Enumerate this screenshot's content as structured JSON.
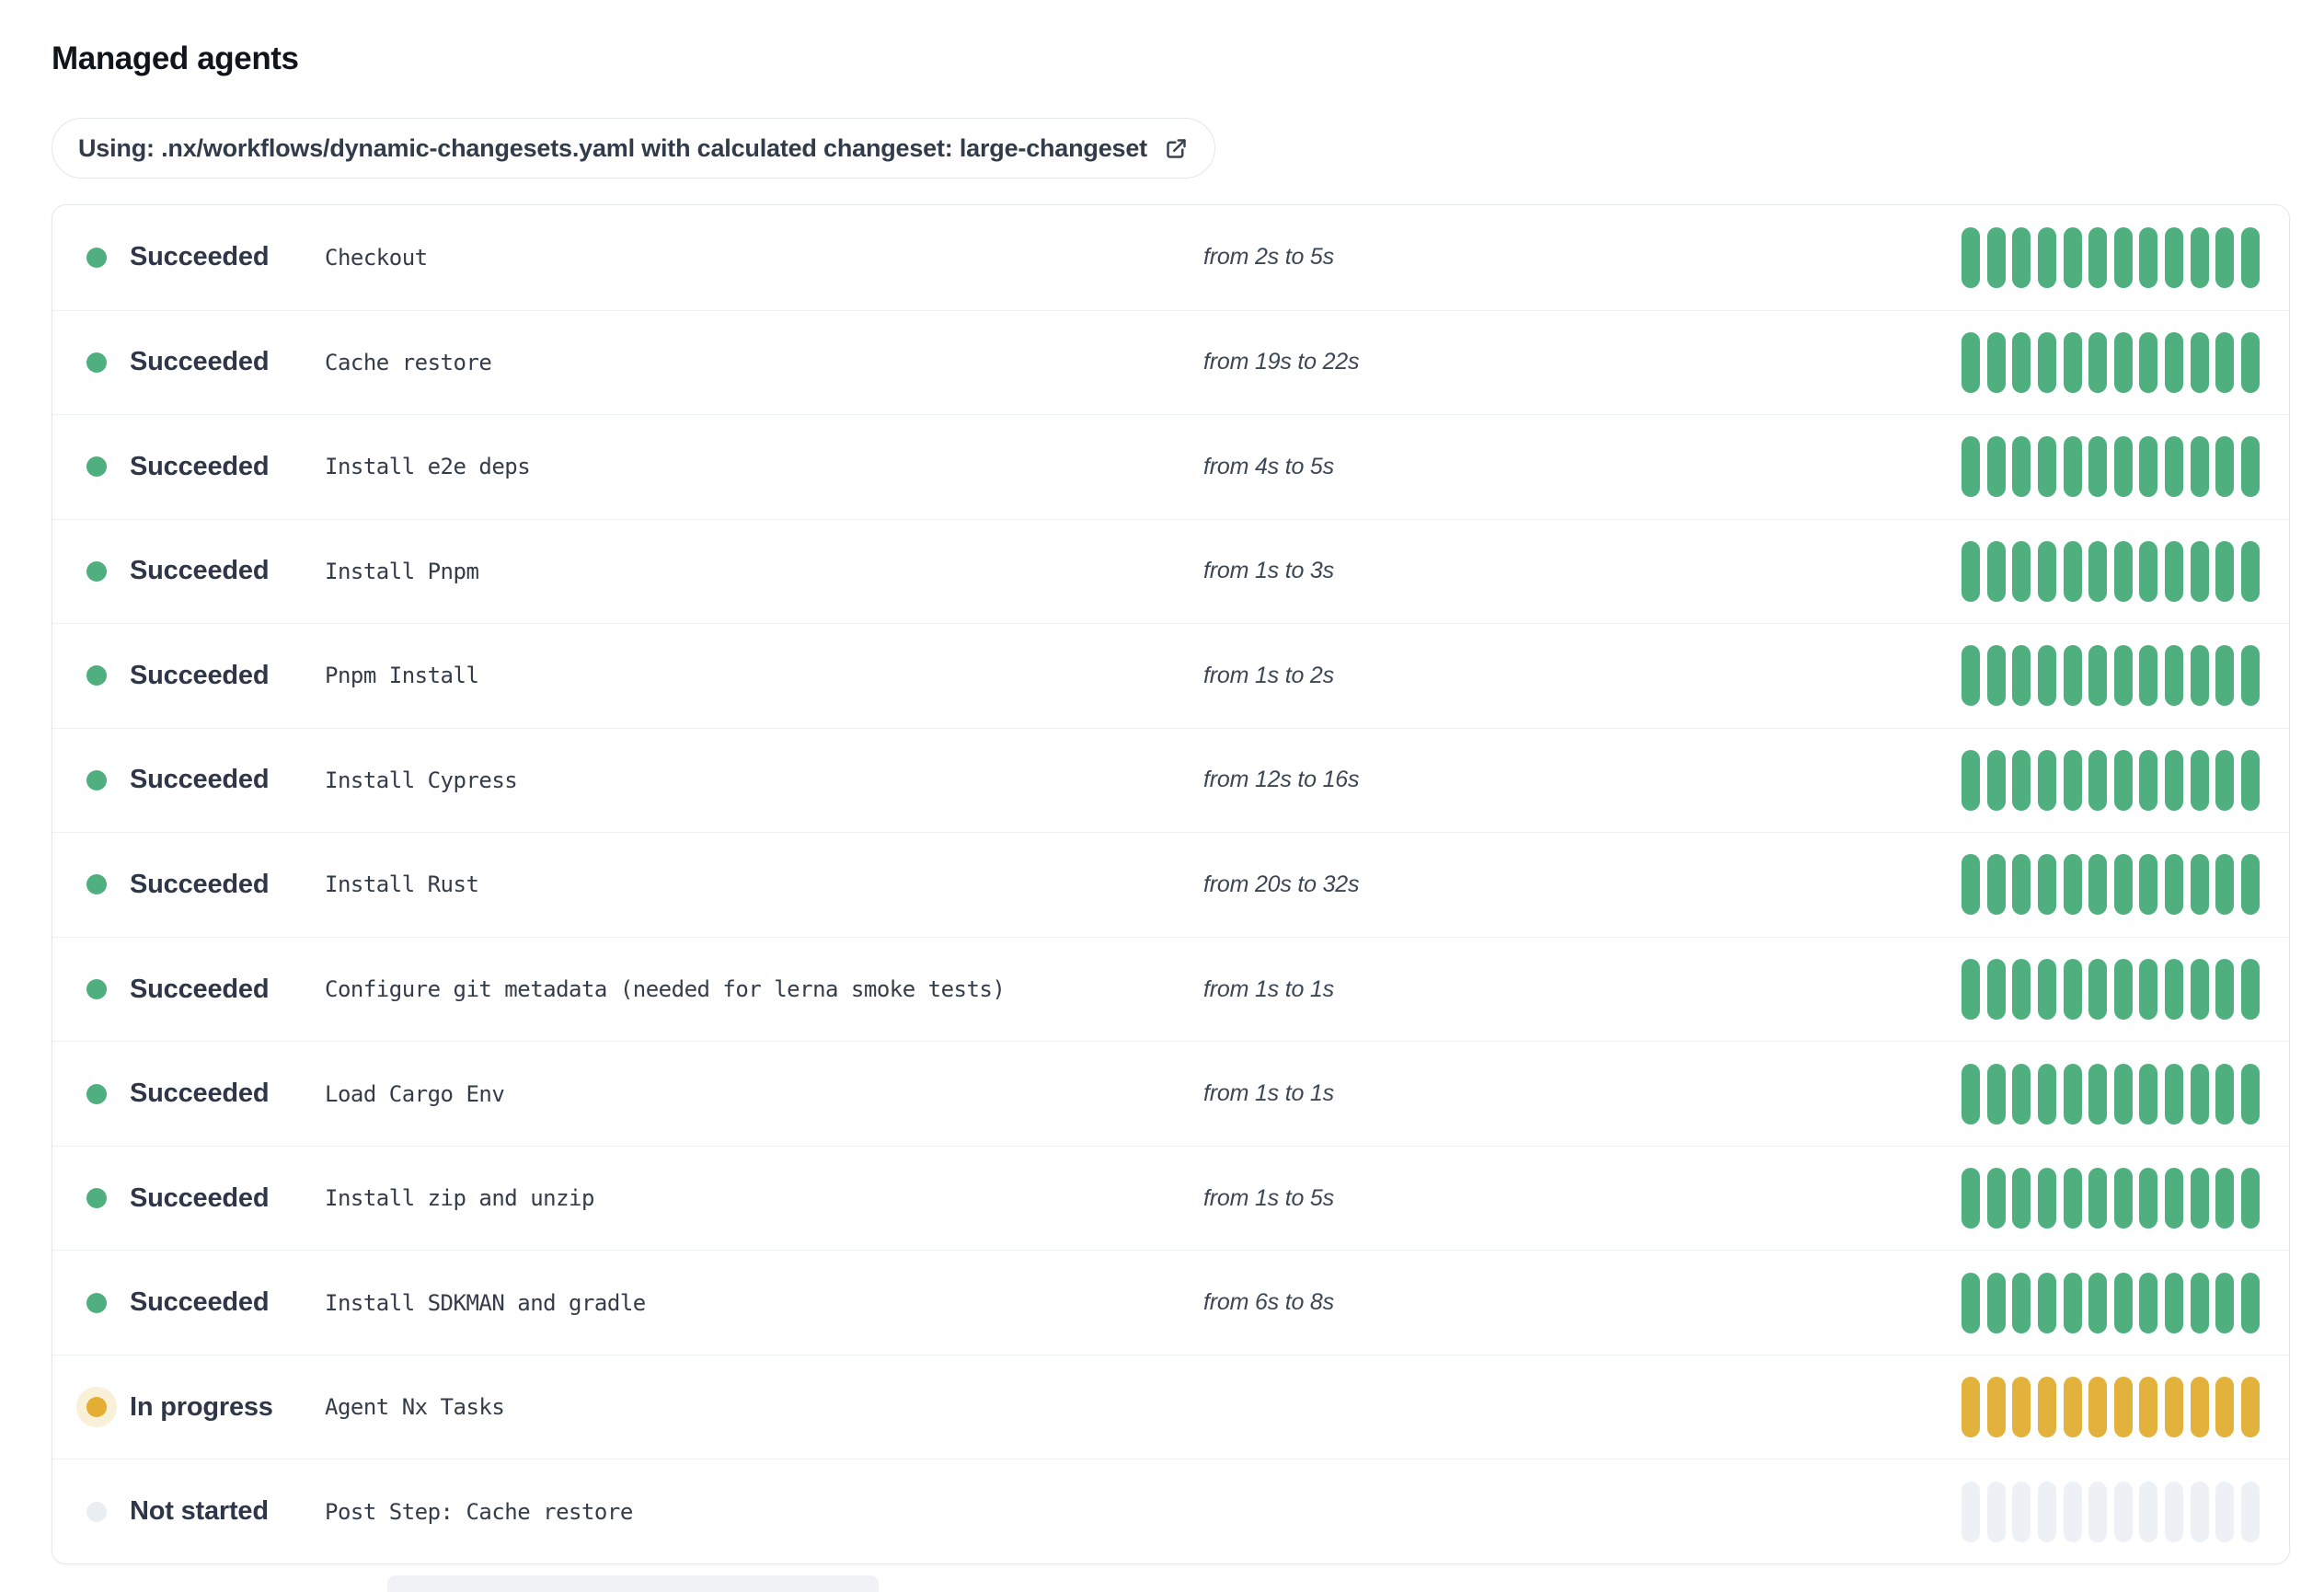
{
  "page": {
    "title": "Managed agents"
  },
  "banner": {
    "label": "Using: .nx/workflows/dynamic-changesets.yaml with calculated changeset: large-changeset",
    "icon": "external-link"
  },
  "colors": {
    "succeeded": "#4FAF7F",
    "in-progress": "#E2B23C",
    "not-started": "#EDF1F6"
  },
  "progress_bar": {
    "segments": 12
  },
  "agents": [
    {
      "status": "succeeded",
      "status_label": "Succeeded",
      "step": "Checkout",
      "duration": "from 2s to 5s"
    },
    {
      "status": "succeeded",
      "status_label": "Succeeded",
      "step": "Cache restore",
      "duration": "from 19s to 22s"
    },
    {
      "status": "succeeded",
      "status_label": "Succeeded",
      "step": "Install e2e deps",
      "duration": "from 4s to 5s"
    },
    {
      "status": "succeeded",
      "status_label": "Succeeded",
      "step": "Install Pnpm",
      "duration": "from 1s to 3s"
    },
    {
      "status": "succeeded",
      "status_label": "Succeeded",
      "step": "Pnpm Install",
      "duration": "from 1s to 2s"
    },
    {
      "status": "succeeded",
      "status_label": "Succeeded",
      "step": "Install Cypress",
      "duration": "from 12s to 16s"
    },
    {
      "status": "succeeded",
      "status_label": "Succeeded",
      "step": "Install Rust",
      "duration": "from 20s to 32s"
    },
    {
      "status": "succeeded",
      "status_label": "Succeeded",
      "step": "Configure git metadata (needed for lerna smoke tests)",
      "duration": "from 1s to 1s"
    },
    {
      "status": "succeeded",
      "status_label": "Succeeded",
      "step": "Load Cargo Env",
      "duration": "from 1s to 1s"
    },
    {
      "status": "succeeded",
      "status_label": "Succeeded",
      "step": "Install zip and unzip",
      "duration": "from 1s to 5s"
    },
    {
      "status": "succeeded",
      "status_label": "Succeeded",
      "step": "Install SDKMAN and gradle",
      "duration": "from 6s to 8s"
    },
    {
      "status": "in-progress",
      "status_label": "In progress",
      "step": "Agent Nx Tasks",
      "duration": ""
    },
    {
      "status": "not-started",
      "status_label": "Not started",
      "step": "Post Step: Cache restore",
      "duration": ""
    }
  ]
}
